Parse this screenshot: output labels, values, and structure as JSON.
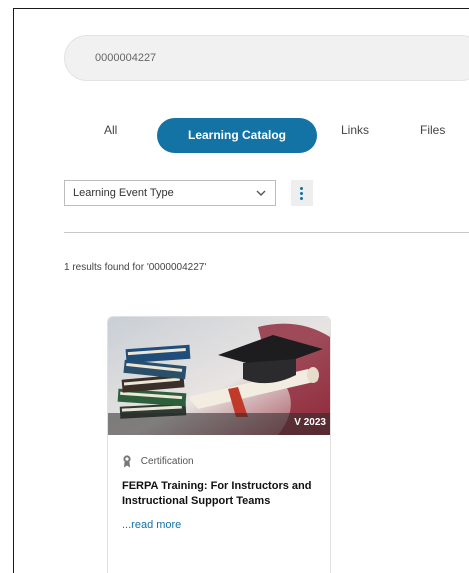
{
  "search": {
    "query": "0000004227"
  },
  "tabs": [
    {
      "label": "All",
      "active": false
    },
    {
      "label": "Learning Catalog",
      "active": true
    },
    {
      "label": "Links",
      "active": false
    },
    {
      "label": "Files",
      "active": false
    }
  ],
  "filter": {
    "selected": "Learning Event Type",
    "more_icon": "vertical-ellipsis-icon"
  },
  "results": {
    "summary": "1 results found for '0000004227'"
  },
  "cards": [
    {
      "image_icon": "books-diploma-graduation-cap-image",
      "version_badge": "V 2023",
      "category_icon": "award-ribbon-icon",
      "category": "Certification",
      "title": "FERPA Training: For Instructors and Instructional Support Teams",
      "read_more": "...read more"
    }
  ],
  "colors": {
    "accent": "#1273a4",
    "search_bg": "#f1f1f1",
    "divider": "#c8c8c8"
  }
}
